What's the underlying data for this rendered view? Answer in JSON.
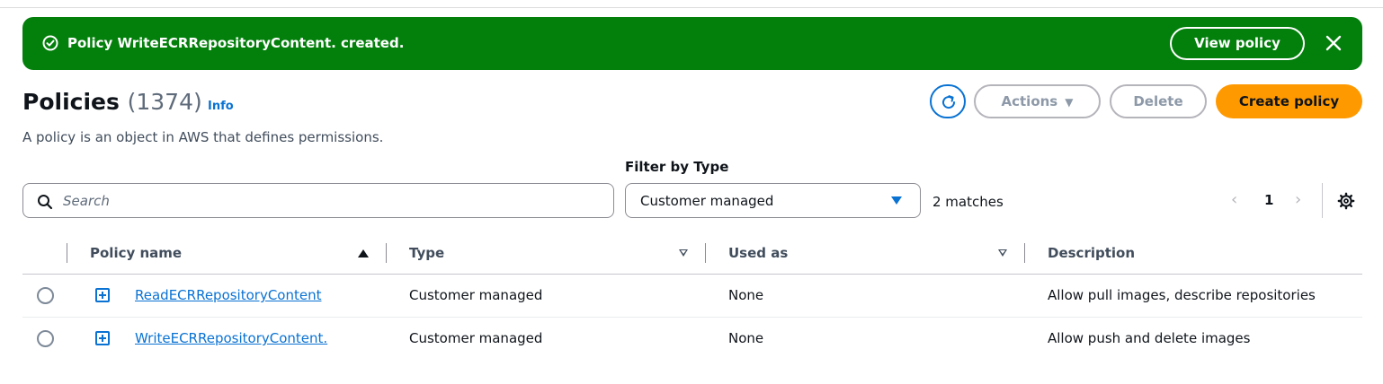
{
  "flash": {
    "message": "Policy WriteECRRepositoryContent. created.",
    "view_label": "View policy",
    "color": "#037f0c"
  },
  "header": {
    "title": "Policies",
    "count": "(1374)",
    "info": "Info",
    "description": "A policy is an object in AWS that defines permissions.",
    "actions_label": "Actions",
    "delete_label": "Delete",
    "create_label": "Create policy",
    "create_color": "#ff9900"
  },
  "filters": {
    "search_placeholder": "Search",
    "type_label": "Filter by Type",
    "type_value": "Customer managed",
    "matches": "2 matches"
  },
  "pagination": {
    "current_page": "1"
  },
  "table": {
    "columns": [
      "Policy name",
      "Type",
      "Used as",
      "Description"
    ],
    "rows": [
      {
        "name": "ReadECRRepositoryContent",
        "type": "Customer managed",
        "used_as": "None",
        "description": "Allow pull images, describe repositories"
      },
      {
        "name": "WriteECRRepositoryContent.",
        "type": "Customer managed",
        "used_as": "None",
        "description": "Allow push and delete images"
      }
    ]
  },
  "icons": {
    "success": "check-circle-icon",
    "close": "close-icon",
    "refresh": "refresh-icon",
    "search": "search-icon",
    "settings": "gear-icon",
    "expand": "expand-plus-icon"
  },
  "accent_color": "#0972d3"
}
